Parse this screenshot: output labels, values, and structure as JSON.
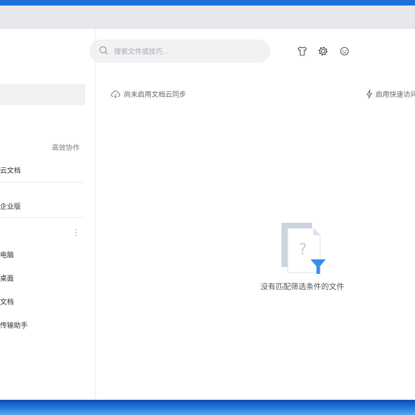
{
  "search": {
    "placeholder": "搜索文件或技巧..."
  },
  "toolbar": {
    "icons": [
      "shirt-icon",
      "gear-icon",
      "smile-icon"
    ]
  },
  "sidebar": {
    "section_label": "高效协作",
    "cloud_docs": "云文档",
    "enterprise": "企业版",
    "items": [
      {
        "label": "电脑"
      },
      {
        "label": "桌面"
      },
      {
        "label": "文档"
      },
      {
        "label": "传输助手"
      }
    ]
  },
  "main": {
    "sync_status": "尚未启用文档云同步",
    "quick_access": "启用快速访问",
    "empty_message": "没有匹配筛选条件的文件"
  },
  "colors": {
    "accent": "#3a8ee6",
    "sidebar_selected": "#f1f1f3"
  }
}
